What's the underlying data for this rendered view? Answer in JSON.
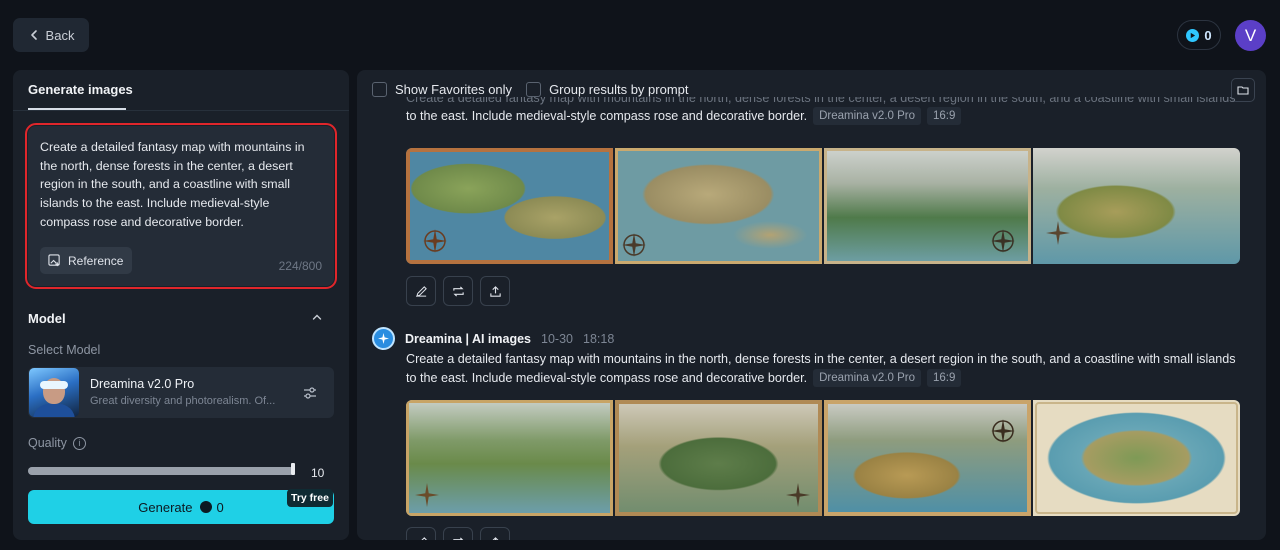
{
  "topbar": {
    "back_label": "Back",
    "credits": "0",
    "avatar_letter": "V"
  },
  "left": {
    "tab": "Generate images",
    "prompt": "Create a detailed fantasy map with mountains in the north, dense forests in the center, a desert region in the south, and a coastline with small islands to the east. Include medieval-style compass rose and decorative border.",
    "reference_label": "Reference",
    "char_count": "224/800",
    "model_section": "Model",
    "select_model_label": "Select Model",
    "model_name": "Dreamina v2.0 Pro",
    "model_desc": "Great diversity and photorealism. Of...",
    "quality_label": "Quality",
    "quality_value": "10",
    "quality_fraction": 0.99,
    "generate_label": "Generate",
    "generate_cost": "0",
    "try_free": "Try free"
  },
  "right": {
    "show_favorites": "Show Favorites only",
    "group_results": "Group results by prompt",
    "group1": {
      "prompt_line1": "Create a detailed fantasy map with mountains in the north, dense forests in the center, a desert region in the south, and a coastline with small islands",
      "prompt_line2": "to the east. Include medieval-style compass rose and decorative border.",
      "model_chip": "Dreamina v2.0 Pro",
      "ratio_chip": "16:9"
    },
    "group2": {
      "author": "Dreamina | AI images",
      "date": "10-30",
      "time": "18:18",
      "prompt_line1": "Create a detailed fantasy map with mountains in the north, dense forests in the center, a desert region in the south, and a coastline with small islands",
      "prompt_line2": "to the east. Include medieval-style compass rose and decorative border.",
      "model_chip": "Dreamina v2.0 Pro",
      "ratio_chip": "16:9"
    }
  },
  "icons": [
    "chevron-left-icon",
    "credit-icon",
    "reference-icon",
    "chevron-up-icon",
    "settings-sliders-icon",
    "info-icon",
    "folder-icon",
    "edit-icon",
    "regenerate-icon",
    "upload-icon",
    "dreamina-logo-icon"
  ]
}
